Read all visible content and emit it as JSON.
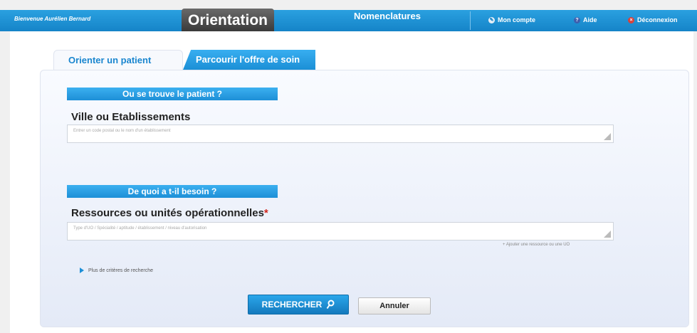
{
  "topbar": {
    "welcome": "Bienvenue Aurélien Bernard",
    "active_tab": "Orientation",
    "nomenclatures": "Nomenclatures",
    "mon_compte": "Mon compte",
    "aide": "Aide",
    "deconnexion": "Déconnexion"
  },
  "tabs": {
    "orienter": "Orienter un patient",
    "parcourir": "Parcourir l'offre de soin"
  },
  "section1": {
    "heading": "Ou se trouve le patient ?",
    "label": "Ville ou Etablissements",
    "placeholder": "Entrer un code postal ou le nom d'un établissement"
  },
  "section2": {
    "heading": "De quoi a t-il besoin ?",
    "label": "Ressources ou unités opérationnelles",
    "required_mark": "*",
    "placeholder": "Type d'UO / Spécialité / aptitude / établissement / niveau d'autorisation",
    "add_link": "+ Ajouter une ressource ou une UO"
  },
  "more_criteria": "Plus de critères de recherche",
  "buttons": {
    "search": "RECHERCHER",
    "cancel": "Annuler"
  },
  "colors": {
    "primary_blue": "#1d8fd7",
    "active_tab_dark": "#3a3a3a",
    "required_red": "#d0261d"
  }
}
